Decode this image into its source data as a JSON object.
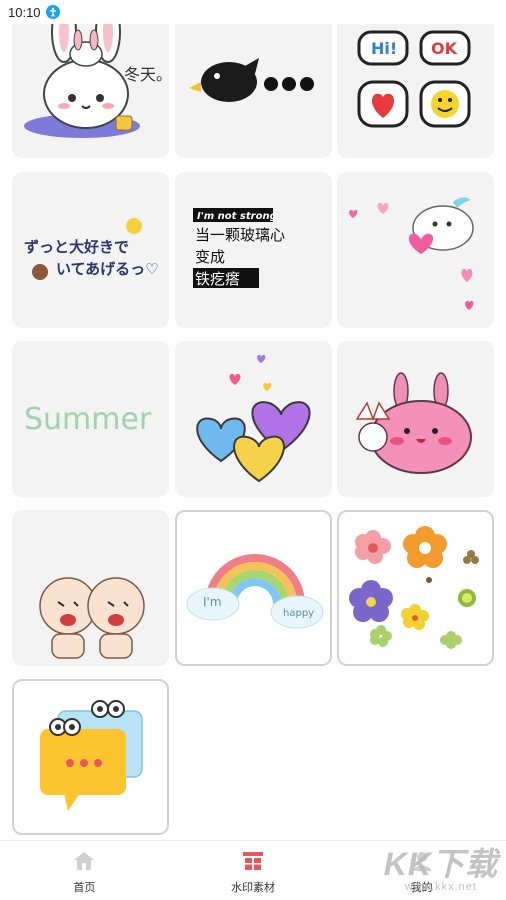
{
  "status_bar": {
    "time": "10:10"
  },
  "tiles": [
    {
      "name": "sticker-winter-bunny",
      "text": "冬天。"
    },
    {
      "name": "sticker-black-bird-dots"
    },
    {
      "name": "sticker-hi-ok-bubbles",
      "text_hi": "Hi!",
      "text_ok": "OK"
    },
    {
      "name": "sticker-japanese-text",
      "text_line1": "ずっと大好きで",
      "text_line2": "いてあげるっ♡"
    },
    {
      "name": "sticker-chinese-quote",
      "text_en": "I'm not strong",
      "text_line1": "当一颗玻璃心",
      "text_line2": "变成",
      "text_line3": "铁疙瘩"
    },
    {
      "name": "sticker-seal-hearts"
    },
    {
      "name": "sticker-summer",
      "text": "Summer"
    },
    {
      "name": "sticker-hearts-cluster"
    },
    {
      "name": "sticker-pink-bunny-blob"
    },
    {
      "name": "sticker-shouting-babies"
    },
    {
      "name": "sticker-rainbow",
      "text_left": "I'm",
      "text_right": "happy"
    },
    {
      "name": "sticker-flowers"
    },
    {
      "name": "sticker-speech-bubbles"
    }
  ],
  "bottom_nav": {
    "items": [
      {
        "label": "首页",
        "icon": "home-icon"
      },
      {
        "label": "水印素材",
        "icon": "watermark-material-icon",
        "active": true
      },
      {
        "label": "我的",
        "icon": "profile-icon"
      }
    ]
  },
  "watermark": {
    "title": "KK下载",
    "url": "www.kkx.net"
  },
  "colors": {
    "active_nav": "#e8575d",
    "inactive_nav": "#cfcfcf",
    "tile_bg": "#f3f3f3",
    "tile_border": "#d2d2d2"
  }
}
